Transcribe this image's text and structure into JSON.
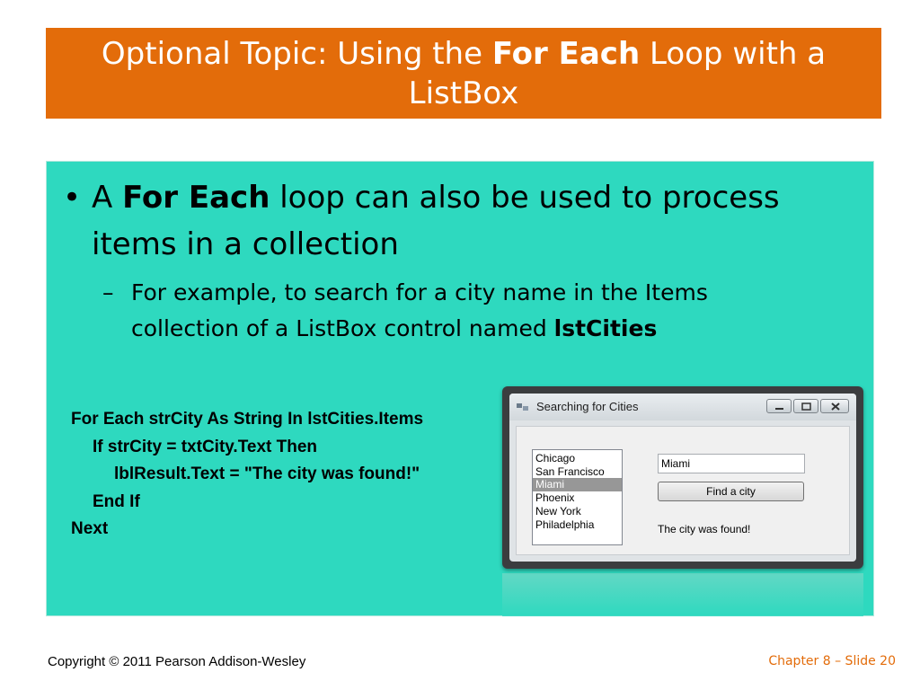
{
  "title": {
    "prefix": "Optional Topic: Using the ",
    "bold": "For Each",
    "suffix": " Loop with a ListBox"
  },
  "bullet": {
    "symbol": "•",
    "prefix": "A ",
    "bold": "For Each",
    "suffix": " loop can also be used to process items in a collection"
  },
  "sub_bullet": {
    "symbol": "–",
    "prefix": "For example, to search for a city name in the Items collection of a ListBox control named ",
    "bold": "lstCities"
  },
  "code": {
    "line1": "For Each strCity As String In lstCities.Items",
    "line2": "If strCity = txtCity.Text Then",
    "line3": "lblResult.Text = \"The city was found!\"",
    "line4": "End If",
    "line5": "Next"
  },
  "window": {
    "title": "Searching for Cities",
    "list_items": [
      "Chicago",
      "San Francisco",
      "Miami",
      "Phoenix",
      "New York",
      "Philadelphia"
    ],
    "selected_item": "Miami",
    "textbox_value": "Miami",
    "button_label": "Find a city",
    "result_label": "The city was found!"
  },
  "footer": {
    "copyright": "Copyright © 2011 Pearson Addison-Wesley",
    "slide": "Chapter 8 – Slide 20"
  },
  "colors": {
    "accent": "#e36c0a",
    "content_background": "#2ed9bf"
  }
}
